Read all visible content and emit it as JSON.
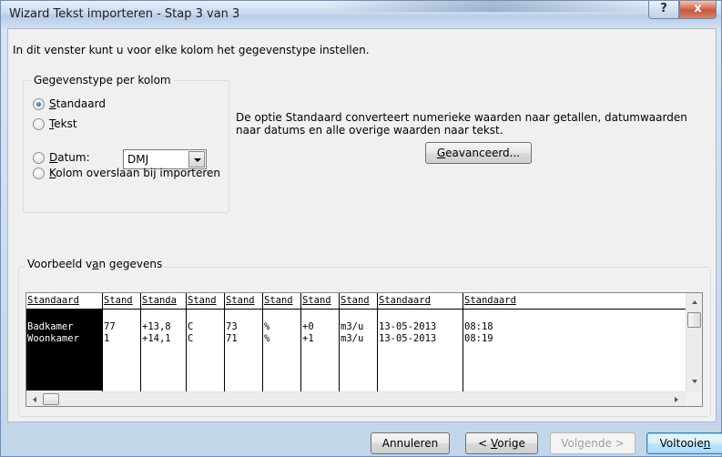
{
  "window": {
    "title": "Wizard Tekst importeren - Stap 3 van 3",
    "help_label": "?",
    "close_label": "x"
  },
  "intro": "In dit venster kunt u voor elke kolom het gegevenstype instellen.",
  "column_type_group": {
    "label": "Gegevenstype per kolom",
    "options": [
      {
        "pre": "",
        "key": "S",
        "post": "tandaard",
        "checked": true
      },
      {
        "pre": "",
        "key": "T",
        "post": "ekst",
        "checked": false
      },
      {
        "pre": "",
        "key": "D",
        "post": "atum:",
        "checked": false
      },
      {
        "pre": "",
        "key": "K",
        "post": "olom overslaan bij importeren",
        "checked": false
      }
    ],
    "date_format": "DMJ"
  },
  "description": "De optie Standaard converteert numerieke waarden naar getallen, datumwaarden naar datums en alle overige waarden naar tekst.",
  "advanced_button": {
    "key": "G",
    "rest": "eavanceerd..."
  },
  "preview": {
    "label_pre": "Voorbeeld v",
    "label_key": "a",
    "label_post": "n gegevens",
    "headers": [
      "Standaard",
      "Stand",
      "Standa",
      "Stand",
      "Stand",
      "Stand",
      "Stand",
      "Stand",
      "Standaard",
      "Standaard"
    ],
    "rows": [
      [
        "Badkamer",
        "77",
        "+13,8",
        "C",
        "73",
        "%",
        "+0",
        "m3/u",
        "13-05-2013",
        "08:18"
      ],
      [
        "Woonkamer",
        "1",
        "+14,1",
        "C",
        "71",
        "%",
        "+1",
        "m3/u",
        "13-05-2013",
        "08:19"
      ]
    ]
  },
  "buttons": {
    "cancel": "Annuleren",
    "previous_pre": "< ",
    "previous_key": "V",
    "previous_post": "orige",
    "next": "Volgende >",
    "finish_pre": "Voltooie",
    "finish_key": "n"
  }
}
